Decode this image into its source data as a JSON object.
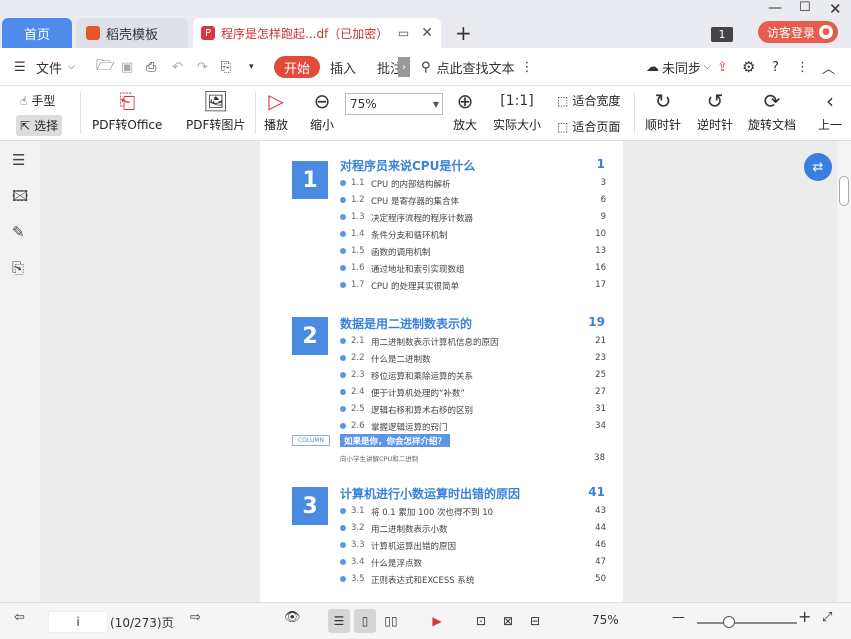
{
  "tabs": {
    "home": "首页",
    "template": "稻壳模板",
    "doc": "程序是怎样跑起...df（已加密）",
    "doc_icon": "P"
  },
  "window": {
    "badge": "1",
    "login": "访客登录"
  },
  "menu": {
    "file": "文件",
    "start": "开始",
    "insert": "插入",
    "annotate": "批注",
    "search": "点此查找文本",
    "sync": "未同步"
  },
  "ribbon": {
    "hand": "手型",
    "select": "选择",
    "pdf_office": "PDF转Office",
    "pdf_image": "PDF转图片",
    "play": "播放",
    "zoom_out": "缩小",
    "zoom": "75%",
    "zoom_in": "放大",
    "actual": "实际大小",
    "fit_width": "适合宽度",
    "fit_page": "适合页面",
    "cw": "顺时针",
    "ccw": "逆时针",
    "rotate": "旋转文档",
    "prev": "上一"
  },
  "toc": {
    "ch1": {
      "num": "1",
      "title": "对程序员来说CPU是什么",
      "page": "1",
      "entries": [
        {
          "n": "1.1",
          "t": "CPU 的内部结构解析",
          "p": "3"
        },
        {
          "n": "1.2",
          "t": "CPU 是寄存器的集合体",
          "p": "6"
        },
        {
          "n": "1.3",
          "t": "决定程序流程的程序计数器",
          "p": "9"
        },
        {
          "n": "1.4",
          "t": "条件分支和循环机制",
          "p": "10"
        },
        {
          "n": "1.5",
          "t": "函数的调用机制",
          "p": "13"
        },
        {
          "n": "1.6",
          "t": "通过地址和索引实现数组",
          "p": "16"
        },
        {
          "n": "1.7",
          "t": "CPU 的处理其实很简单",
          "p": "17"
        }
      ]
    },
    "ch2": {
      "num": "2",
      "title": "数据是用二进制数表示的",
      "page": "19",
      "entries": [
        {
          "n": "2.1",
          "t": "用二进制数表示计算机信息的原因",
          "p": "21"
        },
        {
          "n": "2.2",
          "t": "什么是二进制数",
          "p": "23"
        },
        {
          "n": "2.3",
          "t": "移位运算和乘除运算的关系",
          "p": "25"
        },
        {
          "n": "2.4",
          "t": "便于计算机处理的“补数”",
          "p": "27"
        },
        {
          "n": "2.5",
          "t": "逻辑右移和算术右移的区别",
          "p": "31"
        },
        {
          "n": "2.6",
          "t": "掌握逻辑运算的窍门",
          "p": "34"
        }
      ]
    },
    "column": {
      "label": "COLUMN",
      "title": "如果是你，你会怎样介绍？",
      "sub": "向小学生讲解CPU和二进制",
      "page": "38"
    },
    "ch3": {
      "num": "3",
      "title": "计算机进行小数运算时出错的原因",
      "page": "41",
      "entries": [
        {
          "n": "3.1",
          "t": "将 0.1 累加 100 次也得不到 10",
          "p": "43"
        },
        {
          "n": "3.2",
          "t": "用二进制数表示小数",
          "p": "44"
        },
        {
          "n": "3.3",
          "t": "计算机运算出错的原因",
          "p": "46"
        },
        {
          "n": "3.4",
          "t": "什么是浮点数",
          "p": "47"
        },
        {
          "n": "3.5",
          "t": "正则表达式和EXCESS 系统",
          "p": "50"
        }
      ]
    }
  },
  "status": {
    "page_input": "i",
    "page_count": "(10/273)页",
    "zoom": "75%"
  }
}
